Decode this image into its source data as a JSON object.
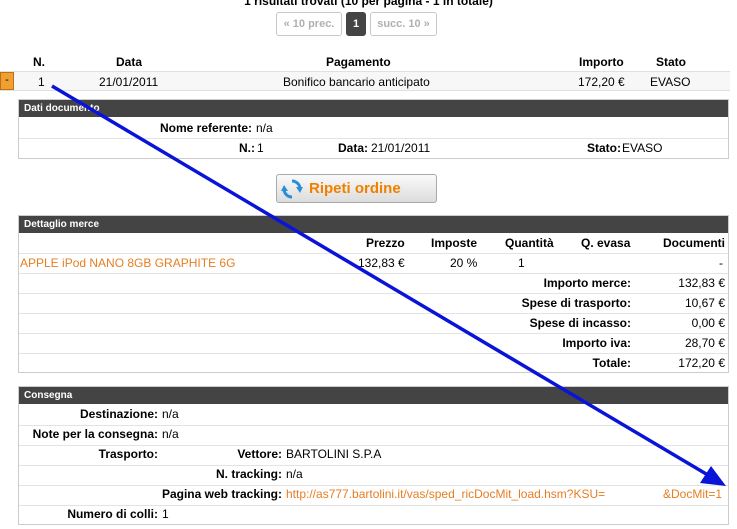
{
  "results": {
    "summary": "1 risultati trovati (10 per pagina - 1 in totale)",
    "prev_label": "« 10 prec.",
    "current_page": "1",
    "next_label": "succ. 10 »"
  },
  "orders": {
    "headers": {
      "n": "N.",
      "data": "Data",
      "pagamento": "Pagamento",
      "importo": "Importo",
      "stato": "Stato"
    },
    "toggle_label": "-",
    "row": {
      "n": "1",
      "data": "21/01/2011",
      "pagamento": "Bonifico bancario anticipato",
      "importo": "172,20 €",
      "stato": "EVASO"
    }
  },
  "documento": {
    "title": "Dati documento",
    "nome_referente_label": "Nome referente:",
    "nome_referente_value": "n/a",
    "n_label": "N.:",
    "n_value": "1",
    "data_label": "Data:",
    "data_value": "21/01/2011",
    "stato_label": "Stato:",
    "stato_value": "EVASO"
  },
  "repeat_button": {
    "label": "Ripeti ordine",
    "icon": "refresh-icon"
  },
  "merce": {
    "title": "Dettaglio merce",
    "headers": {
      "prezzo": "Prezzo",
      "imposte": "Imposte",
      "quantita": "Quantità",
      "q_evasa": "Q. evasa",
      "documenti": "Documenti"
    },
    "item": {
      "name": "APPLE iPod NANO 8GB GRAPHITE 6G",
      "prezzo": "132,83 €",
      "imposte": "20 %",
      "quantita": "1",
      "q_evasa": "",
      "documenti": "-"
    },
    "totals": [
      {
        "label": "Importo merce:",
        "value": "132,83 €"
      },
      {
        "label": "Spese di trasporto:",
        "value": "10,67 €"
      },
      {
        "label": "Spese di incasso:",
        "value": "0,00 €"
      },
      {
        "label": "Importo iva:",
        "value": "28,70 €"
      },
      {
        "label": "Totale:",
        "value": "172,20 €"
      }
    ]
  },
  "consegna": {
    "title": "Consegna",
    "destinazione_label": "Destinazione:",
    "destinazione_value": "n/a",
    "note_label": "Note per la consegna:",
    "note_value": "n/a",
    "trasporto_label": "Trasporto:",
    "vettore_label": "Vettore:",
    "vettore_value": "BARTOLINI S.P.A",
    "tracking_label": "N. tracking:",
    "tracking_value": "n/a",
    "web_tracking_label": "Pagina web tracking:",
    "web_tracking_url": "http://as777.bartolini.it/vas/sped_ricDocMit_load.hsm?KSU=",
    "web_tracking_url_end": "&DocMit=1",
    "colli_label": "Numero di colli:",
    "colli_value": "1"
  },
  "colors": {
    "accent_orange": "#e67e22",
    "panel_header": "#444444",
    "annotation_arrow": "#0a14d8"
  }
}
